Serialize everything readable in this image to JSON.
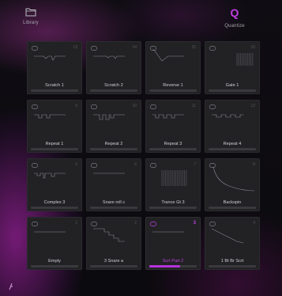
{
  "header": {
    "library_label": "Library",
    "quantize_label": "Quantize",
    "quantize_glyph": "Q",
    "library_icon": "folder-icon",
    "accent": "#c03ee0"
  },
  "pads": [
    {
      "name": "Scratch 1",
      "num": "13",
      "active": false,
      "graph": "scratch1"
    },
    {
      "name": "Scratch 2",
      "num": "14",
      "active": false,
      "graph": "scratch2"
    },
    {
      "name": "Reverse 1",
      "num": "15",
      "active": false,
      "graph": "reverse"
    },
    {
      "name": "Gate 1",
      "num": "16",
      "active": false,
      "graph": "gate"
    },
    {
      "name": "Repeat 1",
      "num": "9",
      "active": false,
      "graph": "repeat1"
    },
    {
      "name": "Repeat 2",
      "num": "10",
      "active": false,
      "graph": "repeat2"
    },
    {
      "name": "Repeat 3",
      "num": "11",
      "active": false,
      "graph": "repeat3"
    },
    {
      "name": "Repeat 4",
      "num": "12",
      "active": false,
      "graph": "repeat4"
    },
    {
      "name": "Complex 3",
      "num": "5",
      "active": false,
      "graph": "complex"
    },
    {
      "name": "Snare roll c",
      "num": "6",
      "active": false,
      "graph": "snare"
    },
    {
      "name": "Trance Gt 3",
      "num": "7",
      "active": false,
      "graph": "trance"
    },
    {
      "name": "Backspin",
      "num": "8",
      "active": false,
      "graph": "backspin"
    },
    {
      "name": "Empty",
      "num": "1",
      "active": false,
      "graph": "empty"
    },
    {
      "name": "3 Snare a",
      "num": "2",
      "active": false,
      "graph": "stairs"
    },
    {
      "name": "Scrt Part 2",
      "num": "3",
      "active": true,
      "graph": "scrt",
      "progress": 0.65
    },
    {
      "name": "1 Bt Br Scrt",
      "num": "4",
      "active": false,
      "graph": "btbr"
    }
  ]
}
